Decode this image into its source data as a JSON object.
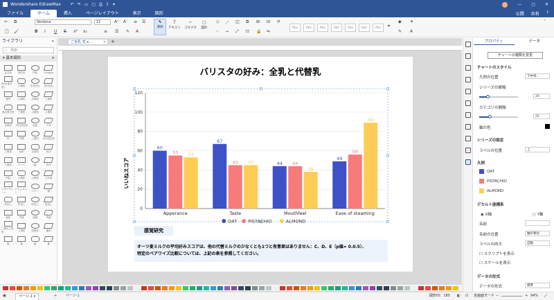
{
  "app": {
    "title": "Wondershare EdrawMax"
  },
  "titlebar": {
    "share": "公開",
    "share2": "共有"
  },
  "menu": [
    "ファイル",
    "ホーム",
    "挿入",
    "ページレイアウト",
    "表示",
    "図形"
  ],
  "ribbon": {
    "font": "Verdana",
    "size": "12",
    "select_label": "選択",
    "text_label": "テキスト",
    "connector_label": "コネクタ",
    "shape_label": "図形",
    "styles": [
      "Abc",
      "Abc",
      "Abc",
      "Abc",
      "Abc",
      "Abc",
      "Abc"
    ]
  },
  "left": {
    "library": "ライブラリ",
    "search_placeholder": "検索",
    "group": "基本図形",
    "shapes": [
      "正方形",
      "長方形",
      "円形",
      "Octagon",
      "矢印(長方形)",
      "六角形",
      "矢印(右)",
      "矢印(左)",
      "長円",
      "六角形",
      "五角形",
      "三角形",
      "角丸長方形",
      "三角形",
      "六角形",
      "八角形",
      "五角形",
      "平行四辺形",
      "台形",
      "十字",
      "円",
      "円環",
      "二重円",
      "平行四辺形",
      "三角形",
      "台形",
      "五角形",
      "矢印",
      "八角形",
      "ハート",
      "星",
      "矢印",
      "円柱",
      "六角形",
      "六角形",
      "立方体",
      "フローチャート",
      "ドキュメント",
      "バナー",
      "帯",
      "吹出し",
      "吹出し",
      "吹出し",
      "吹出し",
      "波形",
      "円弧",
      "波線",
      "円弧",
      "二等辺三角形",
      "三角形",
      "四角形",
      "星形",
      "星",
      "星",
      "星",
      "星"
    ]
  },
  "document": {
    "tab": "ご全乳 式 e...",
    "page_tab": "ページ-1",
    "page_tab_active": "ページ-1"
  },
  "chart_data": {
    "type": "bar",
    "title": "バリスタの好み：全乳と代替乳",
    "ylabel": "いいねスコア",
    "xlabel": "",
    "categories": [
      "Apperance",
      "Taste",
      "Mouthfeel",
      "Ease of steaming"
    ],
    "ylim": [
      0,
      120
    ],
    "yticks": [
      "0",
      "20",
      "40",
      "60",
      "80",
      "100",
      "120"
    ],
    "grid": true,
    "legend_position": "bottom",
    "series": [
      {
        "name": "OAT",
        "color": "#3f51c6",
        "values": [
          60,
          67,
          44,
          49
        ]
      },
      {
        "name": "PISTACHIO",
        "color": "#f77b7b",
        "values": [
          55,
          45,
          44,
          56
        ]
      },
      {
        "name": "ALMOND",
        "color": "#ffcc55",
        "values": [
          53,
          45,
          38,
          89
        ]
      }
    ]
  },
  "notes": {
    "heading": "感覚研究",
    "body1": "オーツ麦ミルクの平均好みスコアは、他の代替ミルクの少なくとも1つと有意差はありません：C、D、E（p値= 0.0.5）、",
    "body2": "特定のペアワイズ比較については、上記の表を参照してください。"
  },
  "properties": {
    "tabs": [
      "プロパティ",
      "データ"
    ],
    "change_type": "チャートの種類を変更",
    "chart_style": "チャートのスタイル",
    "legend_pos_label": "凡例の位置",
    "legend_pos_value": "下中央...",
    "series_gap_label": "シリーズの間隔",
    "series_gap_value": "20",
    "category_gap_label": "カテゴリの間隔",
    "category_gap_value": "25",
    "axis_color_label": "軸の色",
    "series_settings": "シリーズの設定",
    "label_pos_label": "ラベルの位置",
    "label_pos_value": "上",
    "legend_heading": "凡例",
    "legend_items": [
      "OAT",
      "PISTACHIO",
      "ALMOND"
    ],
    "default_axis": "デカルト座標系",
    "x_axis": "X軸",
    "y_axis": "Y軸",
    "name_label": "名前",
    "name_pos_label": "名前の位置",
    "name_pos_value": "軸の要份",
    "label_dir_label": "ラベルの向き",
    "label_dir_value": "自動",
    "show_scrollbar": "スクリプトを表示",
    "show_scale": "スケールを表示",
    "data_format": "データの形式",
    "data_format_label": "データの形式",
    "data_format_value": "標準"
  },
  "status": {
    "shape_id": "図形ID：185",
    "fullscreen": "全画面モード",
    "zoom": "94%"
  }
}
